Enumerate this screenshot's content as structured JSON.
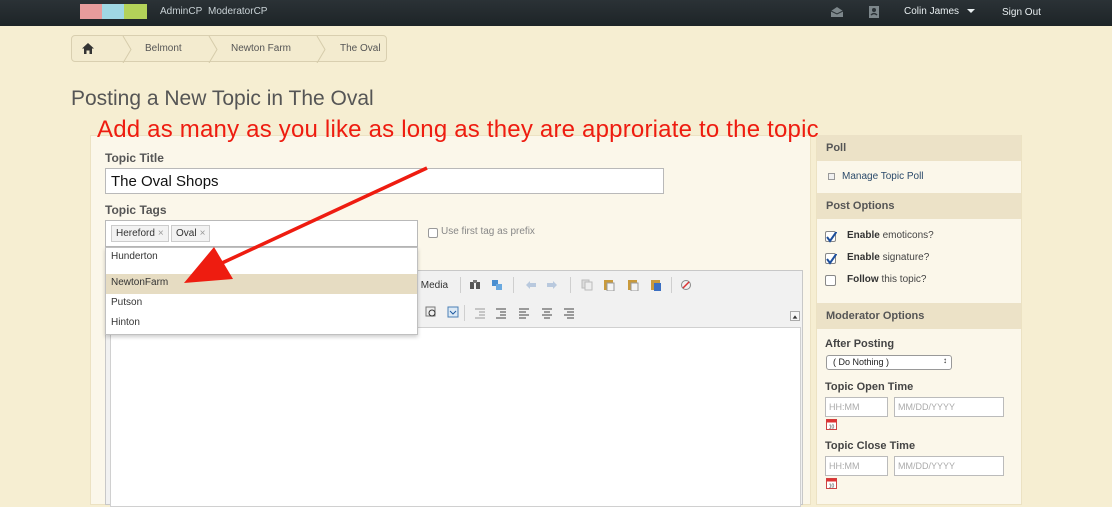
{
  "topbar": {
    "links": [
      "AdminCP",
      "ModeratorCP"
    ],
    "user_name": "Colin James",
    "sign_out": "Sign Out"
  },
  "breadcrumb": {
    "items": [
      "Belmont",
      "Newton Farm",
      "The Oval"
    ]
  },
  "page_title": "Posting a New Topic in The Oval",
  "annotation": "Add as many as you like as long as they are approriate to the topic",
  "form": {
    "topic_title_label": "Topic Title",
    "topic_title_value": "The Oval Shops",
    "topic_tags_label": "Topic Tags",
    "tags": [
      "Hereford",
      "Oval"
    ],
    "tag_remove": "×",
    "prefix_label": "Use first tag as prefix",
    "suggestions": [
      "Hunderton",
      "NewtonFarm",
      "Putson",
      "Hinton"
    ],
    "highlighted_suggestion": "NewtonFarm"
  },
  "editor": {
    "media_label": "y Media"
  },
  "sidebar": {
    "poll_header": "Poll",
    "manage_poll": "Manage Topic Poll",
    "post_options_header": "Post Options",
    "options": [
      {
        "bold": "Enable",
        "rest": " emoticons?",
        "checked": true
      },
      {
        "bold": "Enable",
        "rest": " signature?",
        "checked": true
      },
      {
        "bold": "Follow",
        "rest": " this topic?",
        "checked": false
      }
    ],
    "moderator_header": "Moderator Options",
    "after_posting_label": "After Posting",
    "after_posting_value": "( Do Nothing )",
    "open_time_label": "Topic Open Time",
    "close_time_label": "Topic Close Time",
    "time_placeholder": "HH:MM",
    "date_placeholder": "MM/DD/YYYY"
  },
  "colors": {
    "accent_red": "#ee1c10",
    "background": "#f6eed2",
    "topbar": "#1d2427"
  }
}
